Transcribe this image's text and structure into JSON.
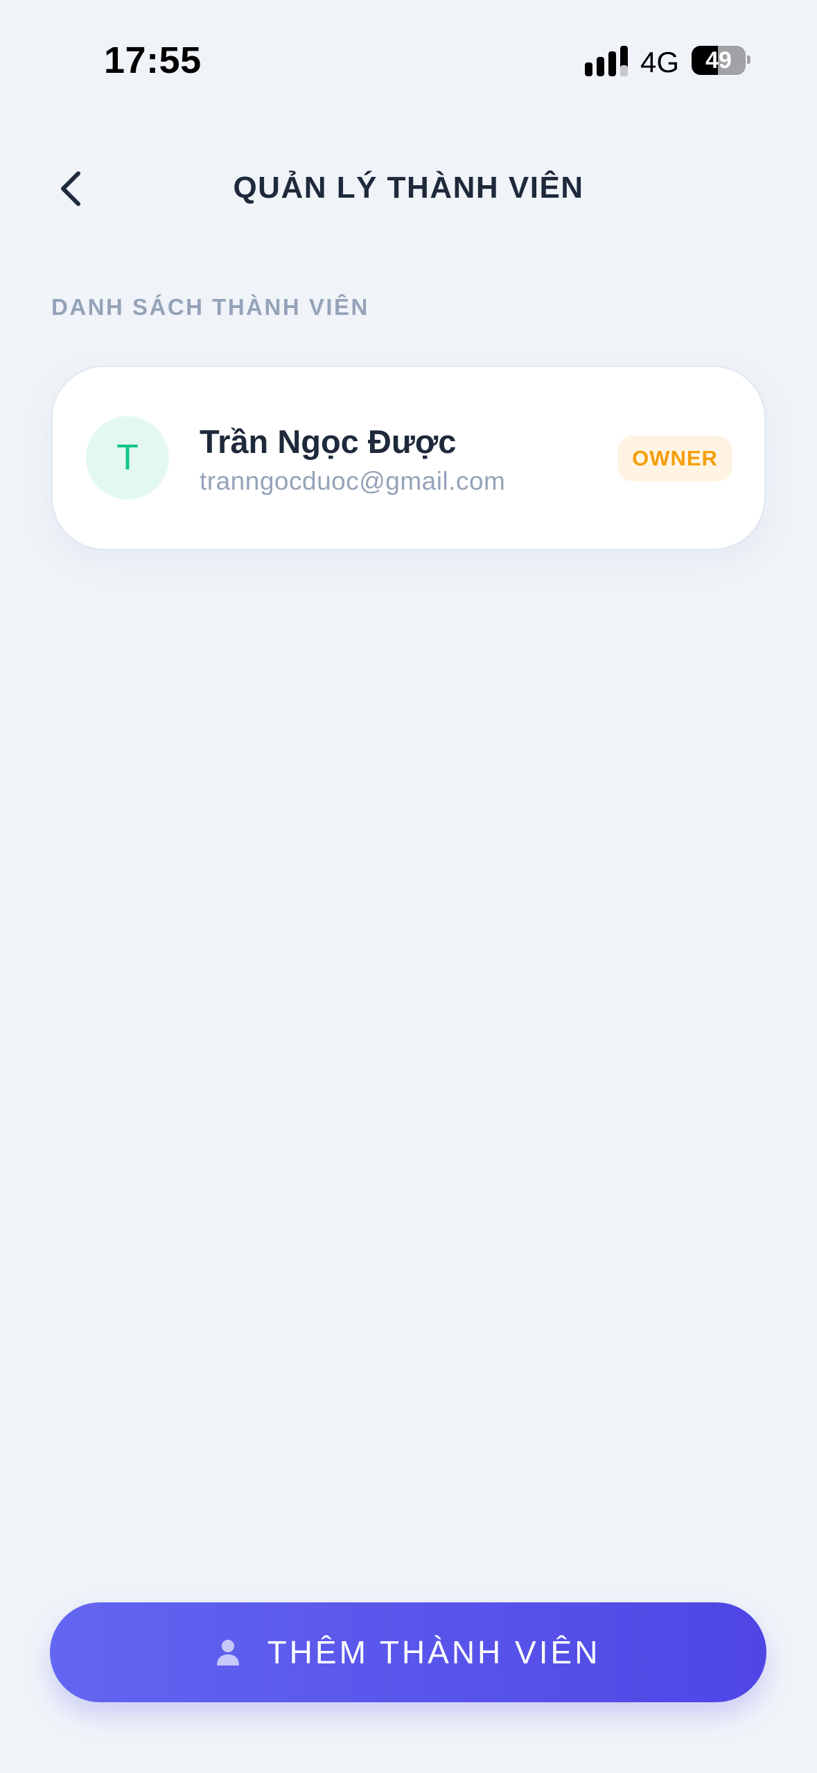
{
  "status_bar": {
    "time": "17:55",
    "network": "4G",
    "battery_level": "49",
    "battery_fraction": 0.49
  },
  "header": {
    "back_icon": "chevron-left-icon",
    "title": "QUẢN LÝ THÀNH VIÊN"
  },
  "members_section": {
    "label": "DANH SÁCH THÀNH VIÊN",
    "members": [
      {
        "avatar_initial": "T",
        "name": "Trần Ngọc Được",
        "email": "tranngocduoc@gmail.com",
        "role": "OWNER"
      }
    ]
  },
  "add_member_button": {
    "icon": "person-icon",
    "label": "THÊM THÀNH VIÊN"
  },
  "colors": {
    "background": "#f0f4f9",
    "title": "#1e293b",
    "muted": "#94a3b8",
    "avatar_bg": "#e3f8f1",
    "avatar_text": "#10c48a",
    "badge_bg": "#fff4e4",
    "badge_text": "#f59e0b",
    "button_start": "#6366f1",
    "button_end": "#4f46e5"
  }
}
